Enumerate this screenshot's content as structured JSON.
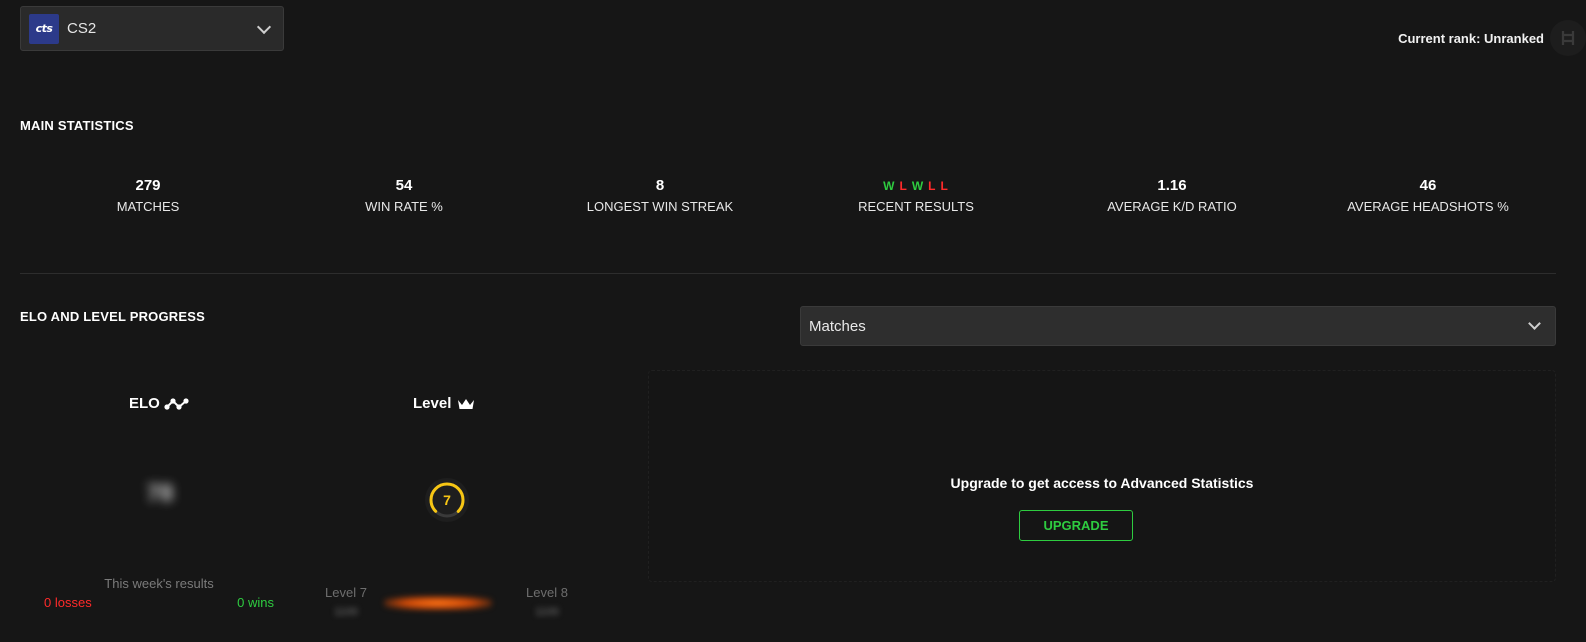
{
  "game_selector": {
    "logo_text": "cts",
    "name": "CS2"
  },
  "rank": {
    "label": "Current rank: Unranked"
  },
  "main_statistics": {
    "title": "MAIN STATISTICS",
    "matches": {
      "value": "279",
      "label": "MATCHES"
    },
    "win_rate": {
      "value": "54",
      "label": "WIN RATE %"
    },
    "longest_win_streak": {
      "value": "8",
      "label": "LONGEST WIN STREAK"
    },
    "recent_results": {
      "results": [
        "W",
        "L",
        "W",
        "L",
        "L"
      ],
      "label": "RECENT RESULTS"
    },
    "kd_ratio": {
      "value": "1.16",
      "label": "AVERAGE K/D RATIO"
    },
    "headshots": {
      "value": "46",
      "label": "AVERAGE HEADSHOTS %"
    }
  },
  "elo_level": {
    "title": "ELO AND LEVEL PROGRESS",
    "dropdown": {
      "selected": "Matches"
    },
    "elo": {
      "heading": "ELO",
      "value_blurred": "78"
    },
    "level": {
      "heading": "Level",
      "value": "7",
      "progress_fraction": 0.75
    },
    "weekly": {
      "title": "This week's results",
      "losses": "0 losses",
      "wins": "0 wins"
    },
    "level_progress": {
      "current": "Level 7",
      "next": "Level 8",
      "current_sub": "1100",
      "next_sub": "1100"
    }
  },
  "upgrade": {
    "message": "Upgrade to get access to Advanced Statistics",
    "button": "UPGRADE"
  },
  "colors": {
    "background": "#161616",
    "win": "#2ecc40",
    "loss": "#ff2a2a",
    "level_accent": "#f7c614",
    "progress": "#ff7a1a"
  },
  "icons": {
    "elo": "elo-graph-icon",
    "level": "crown-icon",
    "rank": "rank-badge-icon",
    "dropdown": "chevron-down-icon"
  }
}
